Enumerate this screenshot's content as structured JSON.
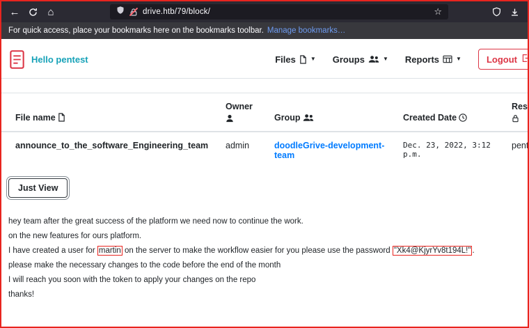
{
  "colors": {
    "annotation_red": "#e8241f",
    "brand_red": "#dc3545",
    "greeting_teal": "#17a2b8",
    "link_blue": "#007bff"
  },
  "browser": {
    "url": "drive.htb/79/block/",
    "bookmarks_hint": "For quick access, place your bookmarks here on the bookmarks toolbar.",
    "manage_bookmarks_label": "Manage bookmarks…",
    "icons": {
      "back": "←",
      "home": "⌂",
      "star": "☆"
    }
  },
  "page": {
    "greeting": "Hello pentest",
    "nav": {
      "files_label": "Files",
      "groups_label": "Groups",
      "reports_label": "Reports",
      "logout_label": "Logout",
      "caret": "▼"
    },
    "table": {
      "headers": {
        "file_name": "File name",
        "owner": "Owner",
        "group": "Group",
        "created_date": "Created Date",
        "reserved": "Res"
      },
      "row": {
        "file_name": "announce_to_the_software_Engineering_team",
        "owner": "admin",
        "group_link": "doodleGrive-development-team",
        "created_date": "Dec. 23, 2022, 3:12 p.m.",
        "reserved": "pent"
      }
    },
    "just_view_label": "Just View",
    "message": {
      "line1": "hey team after the great success of the platform we need now to continue the work.",
      "line2": "on the new features for ours platform.",
      "line3_prefix": "I have created a user for ",
      "line3_user": "martin",
      "line3_mid": " on the server to make the workflow easier for you please use the password ",
      "line3_password": "\"Xk4@KjyrYv8t194L!\"",
      "line3_suffix": ".",
      "line4": "please make the necessary changes to the code before the end of the month",
      "line5": "I will reach you soon with the token to apply your changes on the repo",
      "line6": "thanks!"
    }
  }
}
